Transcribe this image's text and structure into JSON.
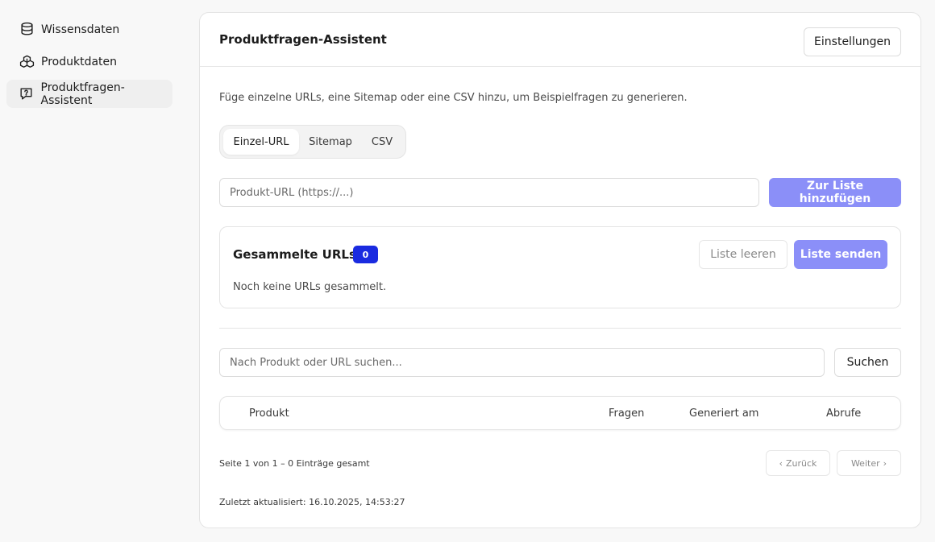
{
  "sidebar": {
    "items": [
      {
        "label": "Wissensdaten",
        "icon": "database-icon"
      },
      {
        "label": "Produktdaten",
        "icon": "boxes-icon"
      },
      {
        "label": "Produktfragen-Assistent",
        "icon": "message-question-icon",
        "active": true
      }
    ]
  },
  "header": {
    "title": "Produktfragen-Assistent",
    "settings_label": "Einstellungen"
  },
  "main": {
    "description": "Füge einzelne URLs, eine Sitemap oder eine CSV hinzu, um Beispielfragen zu generieren.",
    "tabs": [
      {
        "label": "Einzel-URL",
        "active": true
      },
      {
        "label": "Sitemap"
      },
      {
        "label": "CSV"
      }
    ],
    "url_input": {
      "placeholder": "Produkt-URL (https://...)",
      "value": ""
    },
    "add_button": "Zur Liste hinzufügen",
    "collected": {
      "title": "Gesammelte URLs",
      "count": "0",
      "clear_button": "Liste leeren",
      "send_button": "Liste senden",
      "empty_text": "Noch keine URLs gesammelt."
    },
    "search": {
      "placeholder": "Nach Produkt oder URL suchen...",
      "value": "",
      "button": "Suchen"
    },
    "table": {
      "columns": [
        "Produkt",
        "Fragen",
        "Generiert am",
        "Abrufe"
      ],
      "rows": []
    },
    "pagination": {
      "info": "Seite 1 von 1 – 0 Einträge gesamt",
      "prev": "Zurück",
      "next": "Weiter"
    },
    "last_updated": "Zuletzt aktualisiert: 16.10.2025, 14:53:27"
  },
  "colors": {
    "primary": "#8b8ff8",
    "badge": "#1a2be0",
    "background": "#f8f8f8"
  }
}
